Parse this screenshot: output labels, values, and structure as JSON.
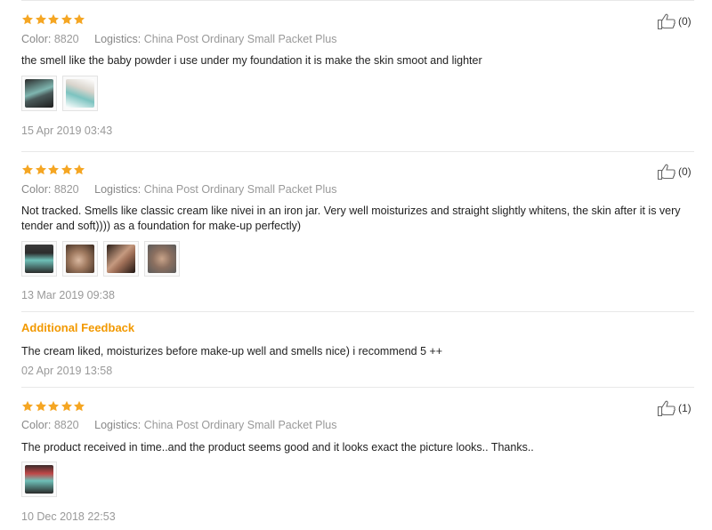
{
  "reviews": [
    {
      "rating": 5,
      "color_label": "Color:",
      "color_value": "8820",
      "logistics_label": "Logistics:",
      "logistics_value": "China Post Ordinary Small Packet Plus",
      "text": "the smell like the baby powder i use under my foundation it is make the skin smoot and lighter",
      "photos": 2,
      "date": "15 Apr 2019 03:43",
      "helpful_count": "(0)"
    },
    {
      "rating": 5,
      "color_label": "Color:",
      "color_value": "8820",
      "logistics_label": "Logistics:",
      "logistics_value": "China Post Ordinary Small Packet Plus",
      "text": "Not tracked. Smells like classic cream like nivei in an iron jar. Very well moisturizes and straight slightly whitens, the skin after it is very tender and soft)))) as a foundation for make-up perfectly)",
      "photos": 4,
      "date": "13 Mar 2019 09:38",
      "helpful_count": "(0)",
      "additional_feedback": {
        "title": "Additional Feedback",
        "text": "The cream liked, moisturizes before make-up well and smells nice) i recommend 5 ++",
        "date": "02 Apr 2019 13:58"
      }
    },
    {
      "rating": 5,
      "color_label": "Color:",
      "color_value": "8820",
      "logistics_label": "Logistics:",
      "logistics_value": "China Post Ordinary Small Packet Plus",
      "text": "The product received in time..and the product seems good and it looks exact the picture looks.. Thanks..",
      "photos": 1,
      "date": "10 Dec 2018 22:53",
      "helpful_count": "(1)"
    }
  ],
  "colors": {
    "star": "#f5a623",
    "additional_title": "#f29900",
    "meta": "#999999",
    "divider": "#e8e8e8"
  },
  "icons": {
    "star": "star-icon",
    "helpful": "thumbs-up-icon"
  }
}
